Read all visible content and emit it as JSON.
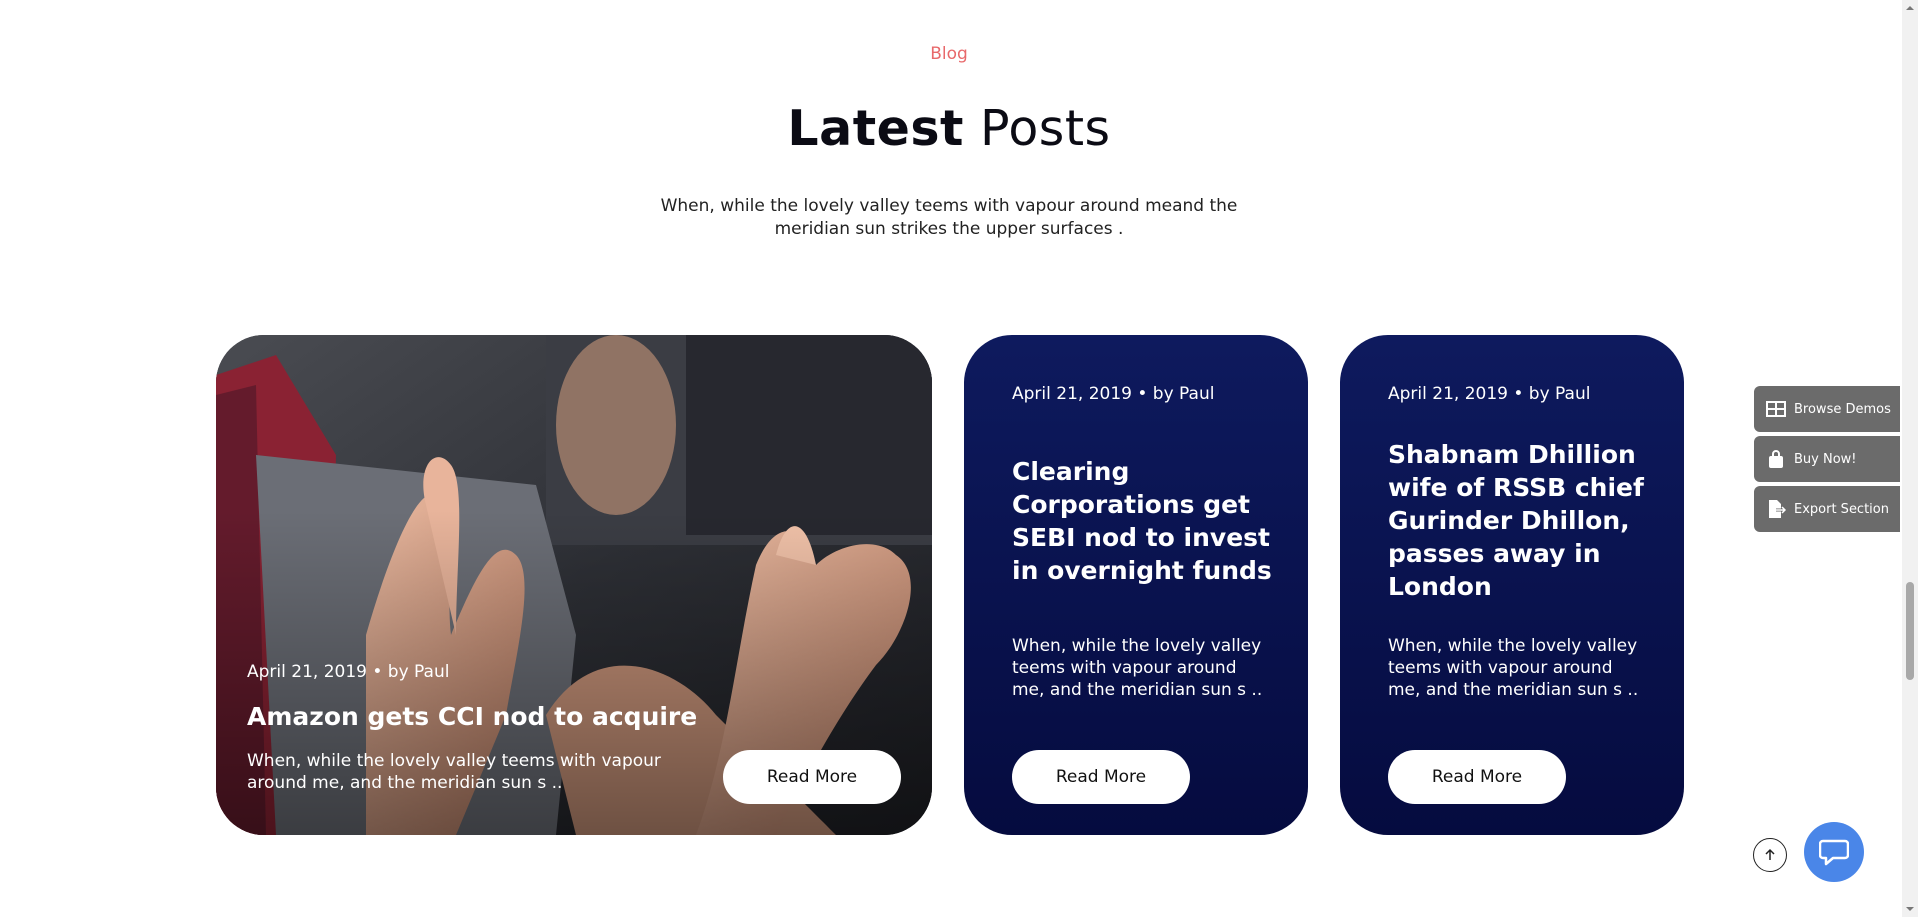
{
  "section": {
    "kicker": "Blog",
    "title_strong": "Latest",
    "title_rest": " Posts",
    "description": "When, while the lovely valley teems with vapour around meand the meridian sun strikes the upper surfaces ."
  },
  "posts": [
    {
      "meta": "April 21, 2019 • by Paul",
      "title": "Amazon gets CCI nod to acquire",
      "excerpt": "When, while the lovely valley teems with vapour around me, and the meridian sun s ..",
      "button": "Read More"
    },
    {
      "meta": "April 21, 2019 • by Paul",
      "title": "Clearing Corporations get SEBI nod to invest in overnight funds",
      "excerpt": "When, while the lovely valley teems with vapour around me, and the meridian sun s ..",
      "button": "Read More"
    },
    {
      "meta": "April 21, 2019 • by Paul",
      "title": "Shabnam Dhillion wife of RSSB chief Gurinder Dhillon, passes away in London",
      "excerpt": "When, while the lovely valley teems with vapour around me, and the meridian sun s ..",
      "button": "Read More"
    }
  ],
  "side_panel": {
    "browse_demos": "Browse Demos",
    "buy_now": "Buy Now!",
    "export_section": "Export Section"
  },
  "icons": {
    "browse": "grid-icon",
    "buy": "shopping-bag-icon",
    "export": "export-file-icon",
    "to_top": "arrow-up-icon",
    "chat": "chat-bubble-icon"
  },
  "colors": {
    "accent": "#e8696b",
    "card_blue_top": "#0e1a5e",
    "card_blue_bottom": "#050b3f",
    "chat": "#4a86e8",
    "side_panel": "#6b6b6b"
  }
}
